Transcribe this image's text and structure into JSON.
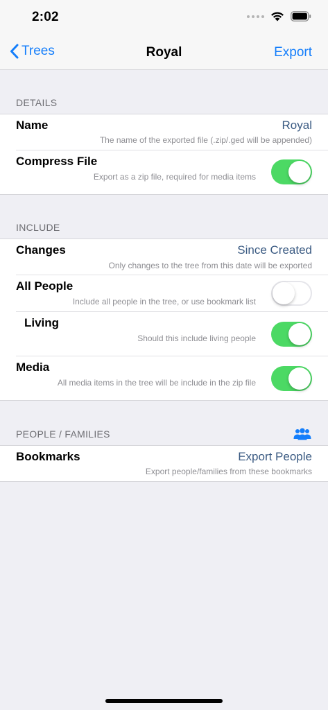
{
  "status_bar": {
    "time": "2:02"
  },
  "nav": {
    "back_label": "Trees",
    "title": "Royal",
    "action_label": "Export"
  },
  "details": {
    "header": "DETAILS",
    "name": {
      "title": "Name",
      "value": "Royal",
      "subtitle": "The name of the exported file (.zip/.ged will be appended)"
    },
    "compress": {
      "title": "Compress File",
      "subtitle": "Export as a zip file, required for media items",
      "enabled": true
    }
  },
  "include": {
    "header": "INCLUDE",
    "changes": {
      "title": "Changes",
      "value": "Since Created",
      "subtitle": "Only changes to the tree from this date will be exported"
    },
    "all_people": {
      "title": "All People",
      "subtitle": "Include all people in the tree, or use bookmark list",
      "enabled": false
    },
    "living": {
      "title": "Living",
      "subtitle": "Should this include living people",
      "enabled": true
    },
    "media": {
      "title": "Media",
      "subtitle": "All media items in the tree will be include in the zip file",
      "enabled": true
    }
  },
  "people_families": {
    "header": "PEOPLE / FAMILIES",
    "icon": "people-group-icon",
    "bookmarks": {
      "title": "Bookmarks",
      "value": "Export People",
      "subtitle": "Export people/families from these bookmarks"
    }
  },
  "colors": {
    "accent": "#147efb",
    "toggle_on": "#4cd964",
    "value_text": "#3a5a82",
    "background": "#efeff4"
  }
}
